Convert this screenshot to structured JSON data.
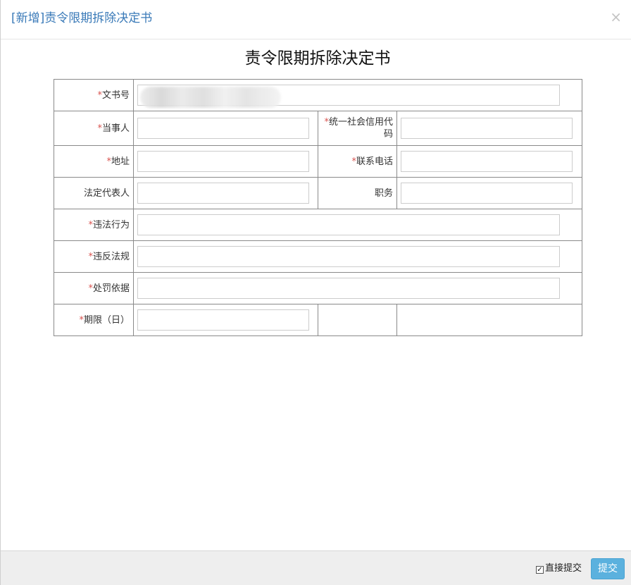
{
  "header": {
    "title": "[新增]责令限期拆除决定书",
    "close_glyph": "×"
  },
  "document": {
    "title": "责令限期拆除决定书"
  },
  "form": {
    "required_mark": "*",
    "doc_number": {
      "label": "文书号",
      "required": true,
      "value": ""
    },
    "party": {
      "label": "当事人",
      "required": true,
      "value": ""
    },
    "credit_code": {
      "label": "统一社会信用代码",
      "required": true,
      "value": ""
    },
    "address": {
      "label": "地址",
      "required": true,
      "value": ""
    },
    "phone": {
      "label": "联系电话",
      "required": true,
      "value": ""
    },
    "legal_rep": {
      "label": "法定代表人",
      "required": false,
      "value": ""
    },
    "position": {
      "label": "职务",
      "required": false,
      "value": ""
    },
    "violation": {
      "label": "违法行为",
      "required": true,
      "value": ""
    },
    "violated_law": {
      "label": "违反法规",
      "required": true,
      "value": ""
    },
    "penalty_basis": {
      "label": "处罚依据",
      "required": true,
      "value": ""
    },
    "deadline_days": {
      "label": "期限（日）",
      "required": true,
      "value": ""
    }
  },
  "footer": {
    "direct_submit_label": "直接提交",
    "direct_submit_checked": true,
    "submit_label": "提交"
  },
  "colors": {
    "title_blue": "#3a7ab8",
    "required_red": "#d9534f",
    "submit_bg": "#5bb1de",
    "footer_bg": "#eeeeee"
  }
}
